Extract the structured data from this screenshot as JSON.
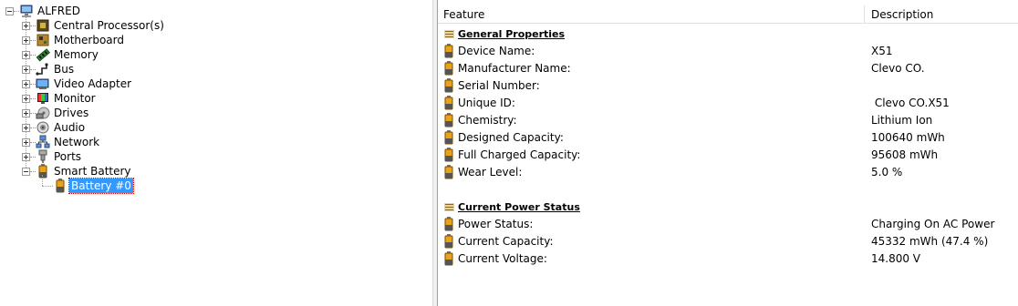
{
  "tree": {
    "root_label": "ALFRED",
    "items": [
      {
        "label": "Central Processor(s)",
        "icon": "cpu-icon"
      },
      {
        "label": "Motherboard",
        "icon": "motherboard-icon"
      },
      {
        "label": "Memory",
        "icon": "memory-icon"
      },
      {
        "label": "Bus",
        "icon": "bus-icon"
      },
      {
        "label": "Video Adapter",
        "icon": "video-adapter-icon"
      },
      {
        "label": "Monitor",
        "icon": "monitor-icon"
      },
      {
        "label": "Drives",
        "icon": "drives-icon"
      },
      {
        "label": "Audio",
        "icon": "audio-icon"
      },
      {
        "label": "Network",
        "icon": "network-icon"
      },
      {
        "label": "Ports",
        "icon": "ports-icon"
      },
      {
        "label": "Smart Battery",
        "icon": "battery-icon"
      }
    ],
    "selected_child_label": "Battery #0"
  },
  "list": {
    "col_feature": "Feature",
    "col_description": "Description",
    "sections": [
      {
        "title": "General Properties",
        "rows": [
          {
            "feature": "Device Name:",
            "description": "X51"
          },
          {
            "feature": "Manufacturer Name:",
            "description": "Clevo CO."
          },
          {
            "feature": "Serial Number:",
            "description": ""
          },
          {
            "feature": "Unique ID:",
            "description": " Clevo CO.X51"
          },
          {
            "feature": "Chemistry:",
            "description": "Lithium Ion"
          },
          {
            "feature": "Designed Capacity:",
            "description": "100640 mWh"
          },
          {
            "feature": "Full Charged Capacity:",
            "description": "95608 mWh"
          },
          {
            "feature": "Wear Level:",
            "description": "5.0 %"
          }
        ]
      },
      {
        "title": "Current Power Status",
        "rows": [
          {
            "feature": "Power Status:",
            "description": "Charging On AC Power"
          },
          {
            "feature": "Current Capacity:",
            "description": "45332 mWh (47.4 %)"
          },
          {
            "feature": "Current Voltage:",
            "description": "14.800 V"
          }
        ]
      }
    ]
  }
}
